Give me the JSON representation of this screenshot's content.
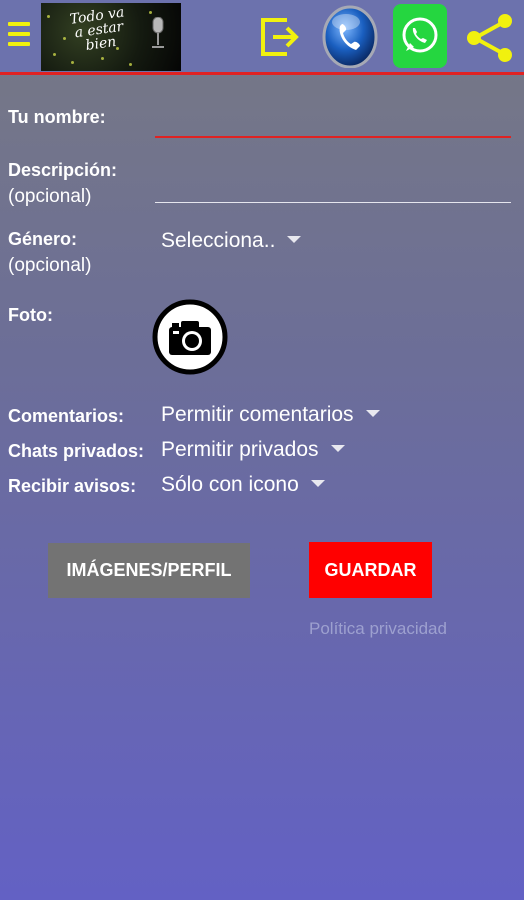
{
  "header": {
    "menu_icon": "menu-icon",
    "logo_text": "Todo va a estar bien",
    "exit_icon": "exit-icon",
    "phone_icon": "phone-icon",
    "whatsapp_icon": "whatsapp-icon",
    "share_icon": "share-icon",
    "colors": {
      "bar": "#6c72ad",
      "accent_line": "#e02222",
      "yellow_icons": "#f1f10e",
      "whatsapp": "#25d640"
    }
  },
  "form": {
    "name": {
      "label": "Tu nombre:",
      "value": ""
    },
    "description": {
      "label": "Descripción:",
      "sublabel": "(opcional)",
      "value": ""
    },
    "gender": {
      "label": "Género:",
      "sublabel": "(opcional)",
      "selected": "Selecciona.."
    },
    "photo": {
      "label": "Foto:",
      "icon": "camera-icon"
    },
    "comments": {
      "label": "Comentarios:",
      "selected": "Permitir comentarios"
    },
    "private_chats": {
      "label": "Chats privados:",
      "selected": "Permitir privados"
    },
    "notifications": {
      "label": "Recibir avisos:",
      "selected": "Sólo con icono"
    }
  },
  "actions": {
    "images_profile_label": "IMÁGENES/PERFIL",
    "save_label": "GUARDAR",
    "privacy_label": "Política privacidad",
    "colors": {
      "images_button": "#737373",
      "save_button": "#ff0000",
      "privacy_link": "#9da0cf"
    }
  }
}
